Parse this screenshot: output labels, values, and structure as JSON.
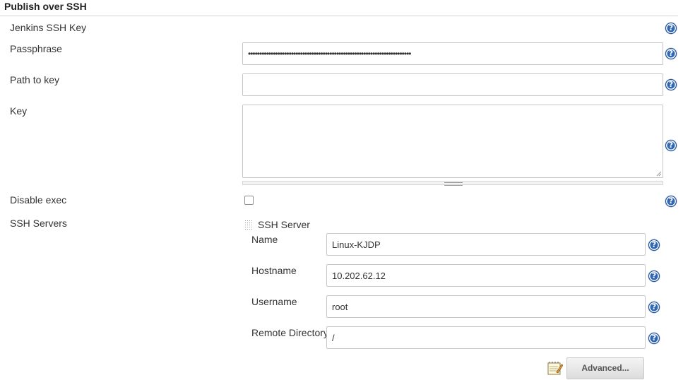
{
  "section": {
    "title": "Publish over SSH"
  },
  "fields": {
    "jenkins_ssh_key": {
      "label": "Jenkins SSH Key"
    },
    "passphrase": {
      "label": "Passphrase",
      "value": "••••••••••••••••••••••••••••••••••••••••••••••••••••••••••••••••••••••••"
    },
    "path_to_key": {
      "label": "Path to key",
      "value": ""
    },
    "key": {
      "label": "Key",
      "value": ""
    },
    "disable_exec": {
      "label": "Disable exec",
      "checked": false
    },
    "ssh_servers": {
      "label": "SSH Servers"
    }
  },
  "ssh_server": {
    "header": "SSH Server",
    "name": {
      "label": "Name",
      "value": "Linux-KJDP"
    },
    "hostname": {
      "label": "Hostname",
      "value": "10.202.62.12"
    },
    "username": {
      "label": "Username",
      "value": "root"
    },
    "remote_directory": {
      "label": "Remote Directory",
      "value": "/"
    },
    "advanced_button": "Advanced..."
  },
  "help_icon_glyph": "?",
  "colors": {
    "help_icon": "#2e67b6",
    "border": "#c7c7c7",
    "divider": "#d3d7cf"
  }
}
